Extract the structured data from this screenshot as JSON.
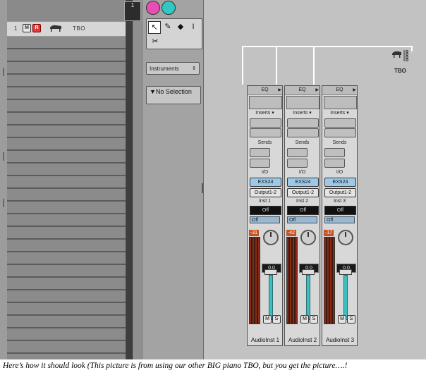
{
  "tracklist": {
    "track": {
      "number": "1",
      "mute_label": "M",
      "record_label": "R",
      "icon": "piano-icon",
      "name": "TBO"
    }
  },
  "timeline": {
    "marker": "1"
  },
  "inspector": {
    "tools": [
      "pointer-tool",
      "pencil-tool",
      "eraser-tool",
      "text-tool",
      "scissors-tool"
    ],
    "view_select": "Instruments",
    "selection_label": "▼No Selection"
  },
  "mixer": {
    "environment_object": {
      "icon": "piano-icon",
      "label": "TBO"
    },
    "channels": [
      {
        "eq": "EQ",
        "inserts": "Inserts ▾",
        "sends": "Sends",
        "io": "I/O",
        "input": "EXS24",
        "output": "Output1-2",
        "inst": "Inst 1",
        "off1": "Off",
        "off2": "Off",
        "peak": "-31",
        "volume": "0.0",
        "mute": "M",
        "solo": "S",
        "name": "AudioInst  1"
      },
      {
        "eq": "EQ",
        "inserts": "Inserts ▾",
        "sends": "Sends",
        "io": "I/O",
        "input": "EXS24",
        "output": "Output1-2",
        "inst": "Inst 2",
        "off1": "Off",
        "off2": "Off",
        "peak": "-42",
        "volume": "0.0",
        "mute": "M",
        "solo": "S",
        "name": "AudioInst  2"
      },
      {
        "eq": "EQ",
        "inserts": "Inserts ▾",
        "sends": "Sends",
        "io": "I/O",
        "input": "EXS24",
        "output": "Output1-2",
        "inst": "Inst 3",
        "off1": "Off",
        "off2": "Off",
        "peak": "-17",
        "volume": "0.0",
        "mute": "M",
        "solo": "S",
        "name": "AudioInst  3"
      }
    ]
  },
  "caption": "Here’s how it should look (This picture is from using our other BIG piano TBO, but you get the picture….!",
  "colors": {
    "record": "#e23a3a",
    "pink_button": "#e84fb5",
    "teal_button": "#2fc9c4",
    "fader": "#3dbfbf",
    "input_slot": "#9cc9e8",
    "peak": "#c45424"
  }
}
